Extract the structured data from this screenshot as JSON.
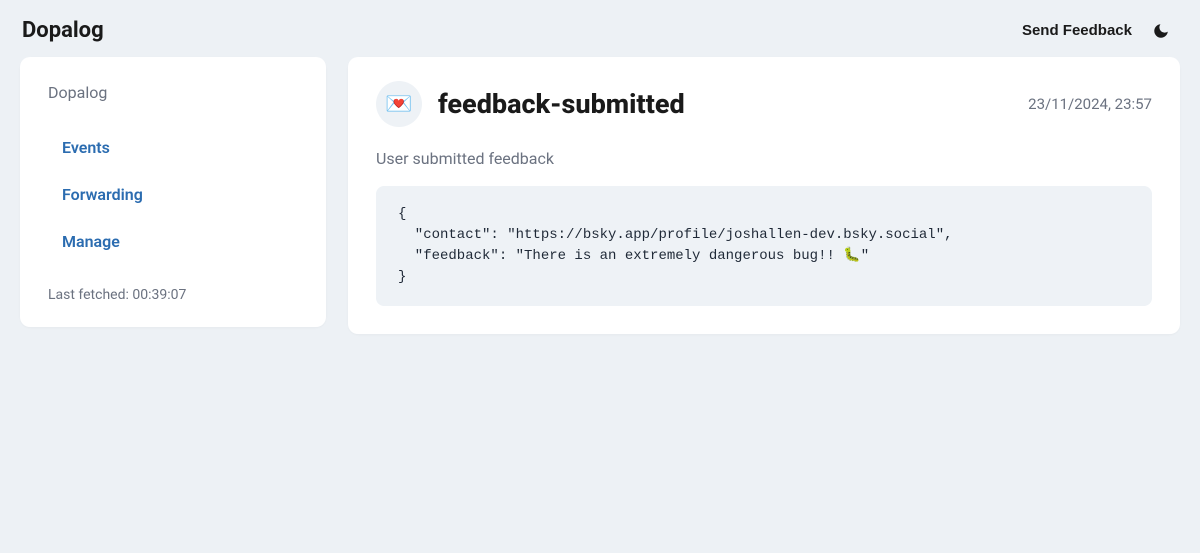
{
  "header": {
    "app_title": "Dopalog",
    "send_feedback_label": "Send Feedback"
  },
  "sidebar": {
    "title": "Dopalog",
    "items": [
      {
        "label": "Events"
      },
      {
        "label": "Forwarding"
      },
      {
        "label": "Manage"
      }
    ],
    "last_fetched": "Last fetched: 00:39:07"
  },
  "event": {
    "icon": "💌",
    "title": "feedback-submitted",
    "timestamp": "23/11/2024, 23:57",
    "subtitle": "User submitted feedback",
    "payload": "{\n  \"contact\": \"https://bsky.app/profile/joshallen-dev.bsky.social\",\n  \"feedback\": \"There is an extremely dangerous bug!! 🐛\"\n}"
  }
}
